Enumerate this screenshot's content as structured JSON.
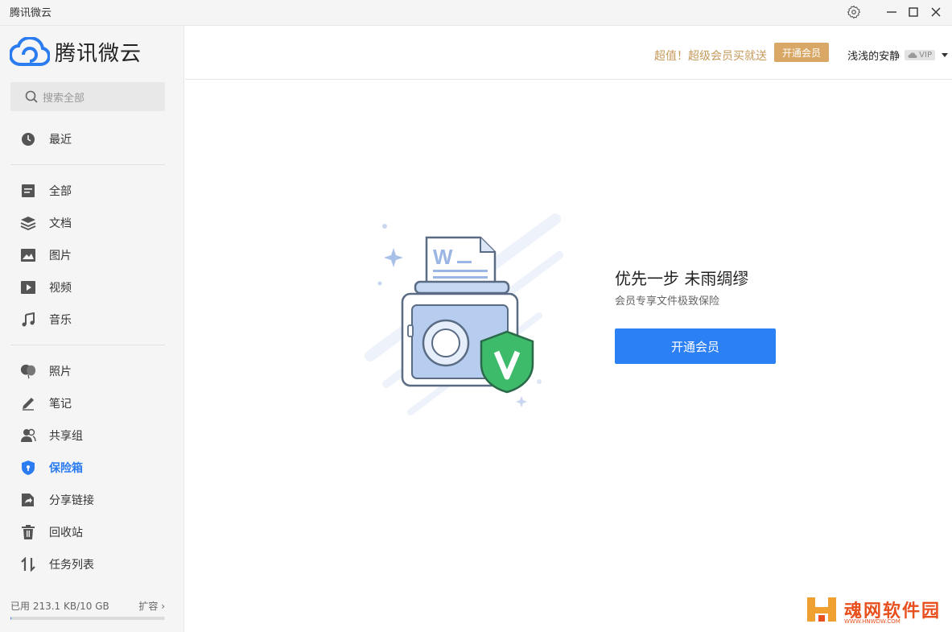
{
  "window": {
    "title": "腾讯微云"
  },
  "brand": {
    "name": "腾讯微云",
    "color": "#2b7cf0"
  },
  "search": {
    "placeholder": "搜索全部",
    "value": ""
  },
  "nav": {
    "recent": {
      "label": "最近",
      "icon": "clock-icon"
    },
    "all": {
      "label": "全部",
      "icon": "file-icon"
    },
    "docs": {
      "label": "文档",
      "icon": "layers-icon"
    },
    "images": {
      "label": "图片",
      "icon": "image-icon"
    },
    "video": {
      "label": "视频",
      "icon": "play-icon"
    },
    "music": {
      "label": "音乐",
      "icon": "music-note-icon"
    },
    "photos": {
      "label": "照片",
      "icon": "balloon-icon"
    },
    "notes": {
      "label": "笔记",
      "icon": "pen-icon"
    },
    "share_group": {
      "label": "共享组",
      "icon": "users-icon"
    },
    "vault": {
      "label": "保险箱",
      "icon": "shield-icon",
      "active": true
    },
    "share_links": {
      "label": "分享链接",
      "icon": "share-icon"
    },
    "recycle": {
      "label": "回收站",
      "icon": "trash-icon"
    },
    "tasks": {
      "label": "任务列表",
      "icon": "transfer-icon"
    }
  },
  "storage": {
    "used_text": "已用 213.1 KB/10 GB",
    "expand_label": "扩容",
    "used_fraction": 2e-05
  },
  "header": {
    "promo": "超值！超级会员买就送",
    "vip_button": "开通会员",
    "username": "浅浅的安静",
    "vip_badge": "VIP"
  },
  "main": {
    "headline": "优先一步 未雨绸缪",
    "subline": "会员专享文件极致保险",
    "cta": "开通会员"
  },
  "watermark": {
    "text": "魂网软件园",
    "url_text": "WWW.HNWDW.COM"
  },
  "colors": {
    "accent": "#2b80f6",
    "gold": "#d9a866",
    "promo": "#c59a5b",
    "shield_green": "#3dbb6b"
  }
}
